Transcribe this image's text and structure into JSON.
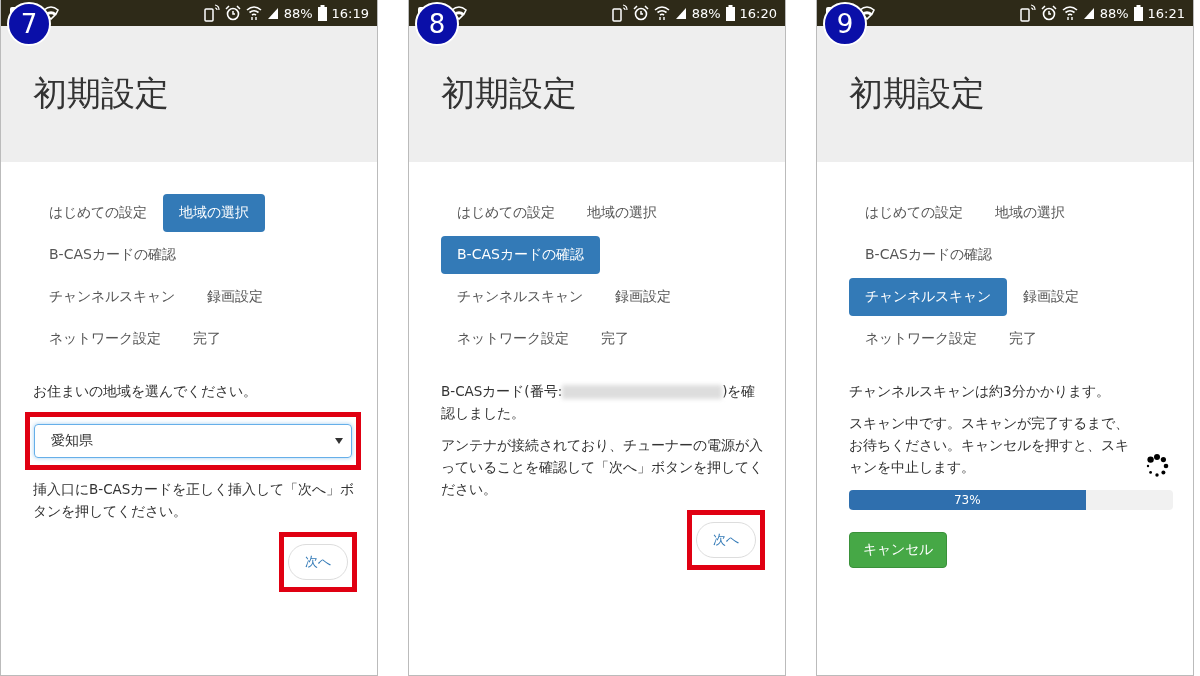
{
  "panels": [
    {
      "badge": "7",
      "status": {
        "battery": "88%",
        "time": "16:19"
      },
      "title": "初期設定",
      "step_rows": [
        {
          "steps": [
            {
              "label": "はじめての設定",
              "selected": false
            },
            {
              "label": "地域の選択",
              "selected": true
            }
          ]
        },
        {
          "steps": [
            {
              "label": "B-CASカードの確認",
              "selected": false
            }
          ]
        },
        {
          "steps": [
            {
              "label": "チャンネルスキャン",
              "selected": false
            },
            {
              "label": "録画設定",
              "selected": false
            }
          ]
        },
        {
          "steps": [
            {
              "label": "ネットワーク設定",
              "selected": false
            },
            {
              "label": "完了",
              "selected": false
            }
          ]
        }
      ],
      "blocks": [
        {
          "kind": "text",
          "text": "お住まいの地域を選んでください。"
        },
        {
          "kind": "select",
          "value": "愛知県",
          "highlighted": true
        },
        {
          "kind": "text",
          "text": "挿入口にB-CASカードを正しく挿入して「次へ」ボタンを押してください。"
        },
        {
          "kind": "next",
          "label": "次へ",
          "highlighted": true
        }
      ]
    },
    {
      "badge": "8",
      "status": {
        "battery": "88%",
        "time": "16:20"
      },
      "title": "初期設定",
      "step_rows": [
        {
          "steps": [
            {
              "label": "はじめての設定",
              "selected": false
            },
            {
              "label": "地域の選択",
              "selected": false
            }
          ]
        },
        {
          "steps": [
            {
              "label": "B-CASカードの確認",
              "selected": true
            }
          ]
        },
        {
          "steps": [
            {
              "label": "チャンネルスキャン",
              "selected": false
            },
            {
              "label": "録画設定",
              "selected": false
            }
          ]
        },
        {
          "steps": [
            {
              "label": "ネットワーク設定",
              "selected": false
            },
            {
              "label": "完了",
              "selected": false
            }
          ]
        }
      ],
      "blocks": [
        {
          "kind": "card",
          "before": "B-CASカード(番号:",
          "after": ")を確認しました。"
        },
        {
          "kind": "text",
          "text": "アンテナが接続されており、チューナーの電源が入っていることを確認して「次へ」ボタンを押してください。"
        },
        {
          "kind": "next",
          "label": "次へ",
          "highlighted": true
        }
      ]
    },
    {
      "badge": "9",
      "status": {
        "battery": "88%",
        "time": "16:21"
      },
      "title": "初期設定",
      "step_rows": [
        {
          "steps": [
            {
              "label": "はじめての設定",
              "selected": false
            },
            {
              "label": "地域の選択",
              "selected": false
            }
          ]
        },
        {
          "steps": [
            {
              "label": "B-CASカードの確認",
              "selected": false
            }
          ]
        },
        {
          "steps": [
            {
              "label": "チャンネルスキャン",
              "selected": true
            },
            {
              "label": "録画設定",
              "selected": false
            }
          ]
        },
        {
          "steps": [
            {
              "label": "ネットワーク設定",
              "selected": false
            },
            {
              "label": "完了",
              "selected": false
            }
          ]
        }
      ],
      "blocks": [
        {
          "kind": "text",
          "text": "チャンネルスキャンは約3分かかります。"
        },
        {
          "kind": "busy",
          "text": "スキャン中です。スキャンが完了するまで、お待ちください。キャンセルを押すと、スキャンを中止します。"
        },
        {
          "kind": "progress",
          "level": 0.73,
          "reading": "73%"
        },
        {
          "kind": "cancel",
          "label": "キャンセル"
        }
      ]
    }
  ]
}
